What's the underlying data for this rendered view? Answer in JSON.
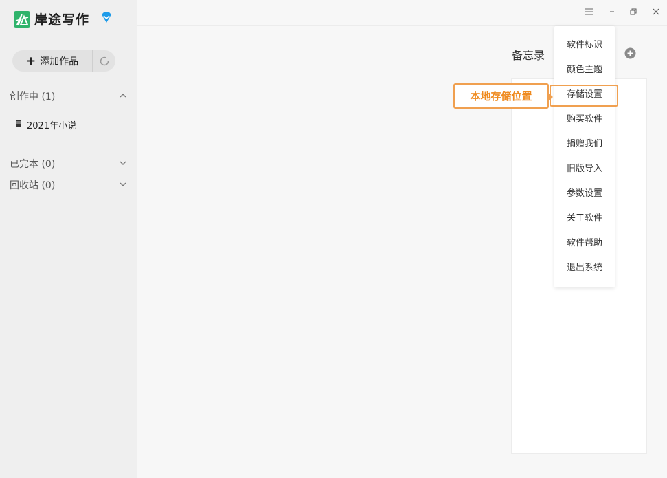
{
  "app": {
    "title": "岸途写作"
  },
  "sidebar": {
    "add_label": "添加作品",
    "sections": [
      {
        "label": "创作中",
        "count": "(1)"
      },
      {
        "label": "已完本",
        "count": "(0)"
      },
      {
        "label": "回收站",
        "count": "(0)"
      }
    ],
    "works": [
      {
        "label": "2021年小说"
      }
    ]
  },
  "main": {
    "memo_title": "备忘录"
  },
  "menu": {
    "items": [
      {
        "label": "软件标识"
      },
      {
        "label": "颜色主题"
      },
      {
        "label": "存储设置"
      },
      {
        "label": "购买软件"
      },
      {
        "label": "捐赠我们"
      },
      {
        "label": "旧版导入"
      },
      {
        "label": "参数设置"
      },
      {
        "label": "关于软件"
      },
      {
        "label": "软件帮助"
      },
      {
        "label": "退出系统"
      }
    ]
  },
  "callout": {
    "text": "本地存储位置"
  },
  "colors": {
    "brand": "#2fb36b",
    "accent": "#f0a050",
    "callout_text": "#ef8a1e",
    "vip": "#1e9be9"
  },
  "icons": {
    "logo": "logo-icon",
    "vip": "diamond-icon",
    "add": "plus-icon",
    "refresh": "refresh-icon",
    "book": "book-icon",
    "menu": "hamburger-icon",
    "minimize": "minimize-icon",
    "restore": "restore-icon",
    "close": "close-icon",
    "memo_add": "plus-circle-icon"
  }
}
